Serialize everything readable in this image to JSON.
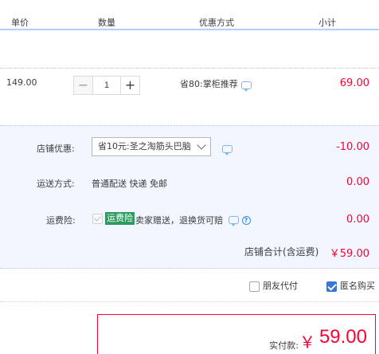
{
  "header": {
    "col_price": "单价",
    "col_qty": "数量",
    "col_promo": "优惠方式",
    "col_subtotal": "小计"
  },
  "item": {
    "price": "149.00",
    "qty_minus": "−",
    "qty_value": "1",
    "qty_plus": "+",
    "promo": "省80:掌柜推荐",
    "subtotal": "69.00"
  },
  "shop": {
    "discount_label": "店铺优惠:",
    "discount_selected": "省10元:圣之淘筋头巴脑",
    "discount_amount": "-10.00",
    "shipping_label": "运送方式:",
    "shipping_value": "普通配送 快递 免邮",
    "shipping_amount": "0.00",
    "insurance_label": "运费险:",
    "insurance_tag": "运费险",
    "insurance_text": "卖家赠送，退换货可赔",
    "insurance_help": "?",
    "insurance_amount": "0.00",
    "total_label": "店铺合计(含运费)",
    "total_value": "￥59.00"
  },
  "options": {
    "friend_pay": "朋友代付",
    "anonymous": "匿名购买"
  },
  "payment": {
    "label": "实付款:",
    "currency": "￥",
    "amount": "59.00"
  },
  "colors": {
    "accent_red": "#ff0036",
    "accent_blue": "#3a75d8",
    "shop_bg": "#f1f6ff",
    "insurance_green": "#2f9a5f"
  }
}
